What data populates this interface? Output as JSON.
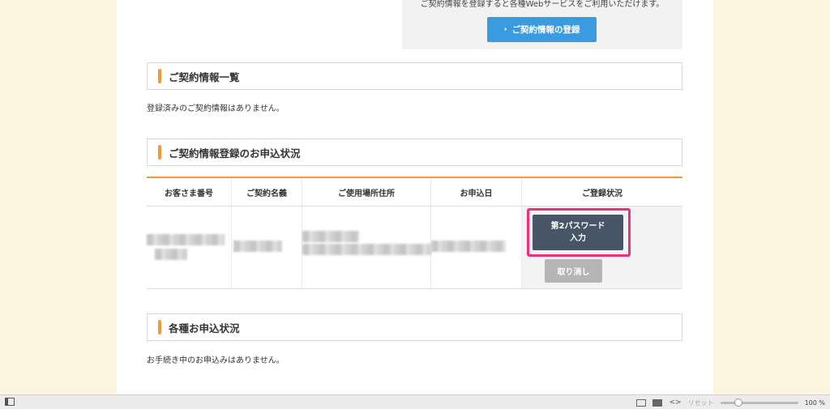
{
  "register_box": {
    "note": "ご契約情報を登録すると各種Webサービスをご利用いただけます。",
    "button_icon": "chevron-right-icon",
    "button_label": "ご契約情報の登録"
  },
  "contract_list": {
    "title": "ご契約情報一覧",
    "message": "登録済みのご契約情報はありません。"
  },
  "application_status": {
    "title": "ご契約情報登録のお申込状況",
    "columns": [
      "お客さま番号",
      "ご契約名義",
      "ご使用場所住所",
      "お申込日",
      "ご登録状況"
    ],
    "row": {
      "password_button_line1": "第2パスワード",
      "password_button_line2": "入力",
      "cancel_button": "取り消し"
    }
  },
  "other_status": {
    "title": "各種お申込状況",
    "message": "お手続き中のお申込みはありません。"
  },
  "statusbar": {
    "code_icon": "<>",
    "reset_label": "リセット",
    "zoom_level": "100 %",
    "zoom_fraction": 0.2
  },
  "colors": {
    "accent_orange": "#f0993a",
    "primary_blue": "#3a9be0",
    "dark_button": "#475566",
    "highlight_pink": "#ee2f7c"
  }
}
